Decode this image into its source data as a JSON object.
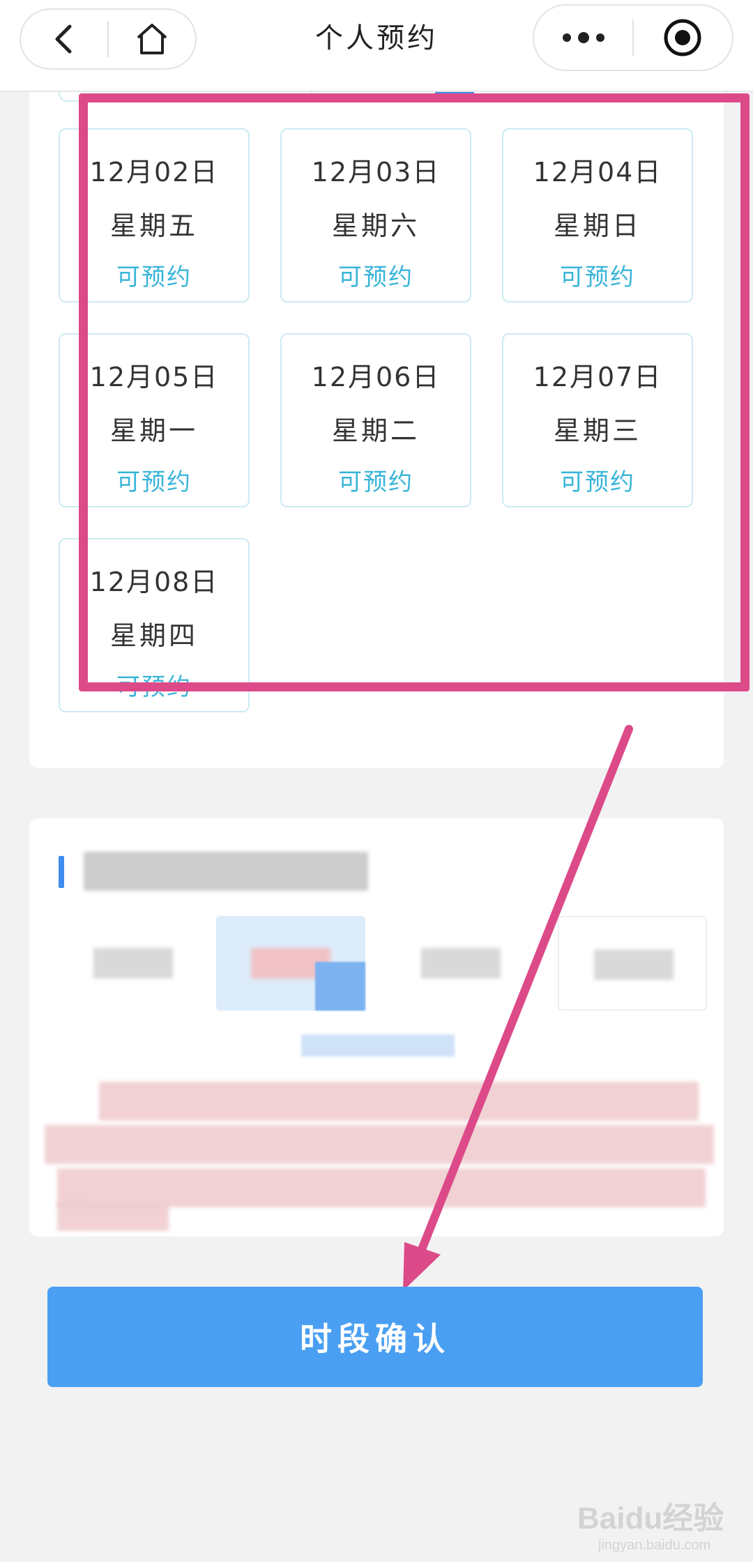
{
  "header": {
    "title": "个人预约",
    "back_icon": "chevron-left-icon",
    "home_icon": "home-icon",
    "more_icon": "more-dots-icon",
    "record_icon": "target-circle-icon"
  },
  "days": [
    {
      "date": "12月02日",
      "weekday": "星期五",
      "status": "可预约"
    },
    {
      "date": "12月03日",
      "weekday": "星期六",
      "status": "可预约"
    },
    {
      "date": "12月04日",
      "weekday": "星期日",
      "status": "可预约"
    },
    {
      "date": "12月05日",
      "weekday": "星期一",
      "status": "可预约"
    },
    {
      "date": "12月06日",
      "weekday": "星期二",
      "status": "可预约"
    },
    {
      "date": "12月07日",
      "weekday": "星期三",
      "status": "可预约"
    },
    {
      "date": "12月08日",
      "weekday": "星期四",
      "status": "可预约"
    }
  ],
  "confirm_button": {
    "label": "时段确认"
  },
  "watermark": {
    "text": "Baidu经验",
    "sub": "jingyan.baidu.com"
  },
  "colors": {
    "accent_blue": "#4a9ff2",
    "status_cyan": "#38b4d9",
    "highlight_pink": "#dc4a89"
  }
}
